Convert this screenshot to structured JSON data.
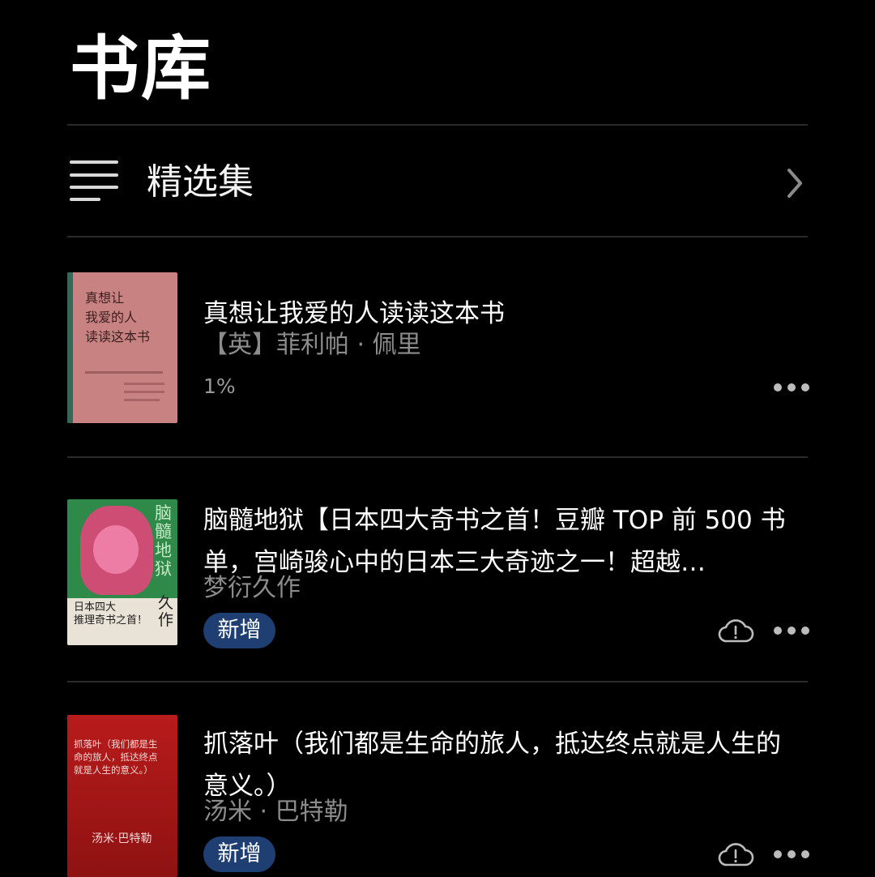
{
  "header": {
    "title": "书库"
  },
  "collections": {
    "label": "精选集",
    "icon": "list-icon",
    "chevron": "chevron-right-icon"
  },
  "books": [
    {
      "title": "真想让我爱的人读读这本书",
      "author": "【英】菲利帕 · 佩里",
      "progress": "1%",
      "cover": {
        "bg": "#c98282",
        "spine": "#2f6b57",
        "lines": [
          "真想让",
          "我爱的人",
          "读读这本书"
        ]
      }
    },
    {
      "title": "脑髓地狱【日本四大奇书之首！豆瓣 TOP 前 500 书单，宫崎骏心中的日本三大奇迹之一！超越…",
      "author": "梦衍久作",
      "badge": "新增",
      "cover": {
        "bg": "#2f8a4a",
        "accent": "#e0467a",
        "vertical": "脑髓地狱",
        "band_lines": [
          "日本四大",
          "推理奇书之首！"
        ],
        "author_glyphs": "久作"
      }
    },
    {
      "title": "抓落叶（我们都是生命的旅人，抵达终点就是人生的意义。）",
      "author": "汤米 · 巴特勒",
      "badge": "新增",
      "cover": {
        "bg": "#a51616",
        "lines": [
          "抓落叶（我们都是生",
          "命的旅人，抵达终点",
          "就是人生的意义。）"
        ],
        "author": "汤米·巴特勒"
      }
    }
  ]
}
